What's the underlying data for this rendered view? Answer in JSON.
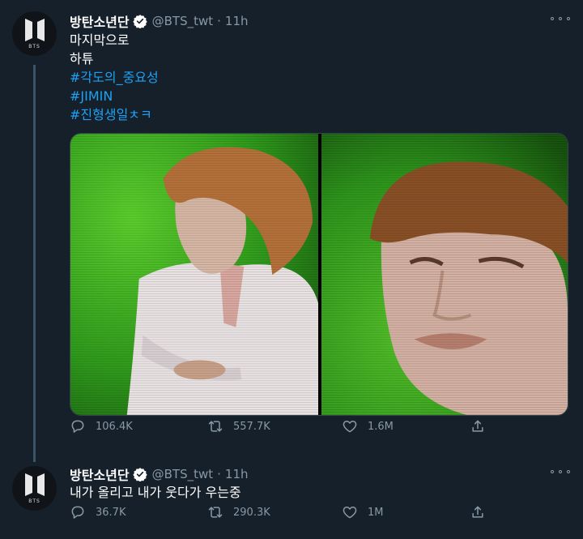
{
  "tweets": [
    {
      "display_name": "방탄소년단",
      "handle": "@BTS_twt",
      "separator": "·",
      "time": "11h",
      "avatar_logo": "BTS",
      "text_lines": [
        "마지막으로",
        "하튜"
      ],
      "hashtags": [
        "#각도의_중요성",
        "#JIMIN",
        "#진형생일ㅊㅋ"
      ],
      "media": [
        {
          "description_icon": "photo-icon"
        },
        {
          "description_icon": "photo-icon"
        }
      ],
      "stats": {
        "replies": "106.4K",
        "retweets": "557.7K",
        "likes": "1.6M"
      }
    },
    {
      "display_name": "방탄소년단",
      "handle": "@BTS_twt",
      "separator": "·",
      "time": "11h",
      "avatar_logo": "BTS",
      "text_lines": [
        "내가 올리고 내가 웃다가 우는중"
      ],
      "stats": {
        "replies": "36.7K",
        "retweets": "290.3K",
        "likes": "1M"
      }
    }
  ],
  "colors": {
    "background": "#15202b",
    "hashtag": "#1da1f2",
    "muted": "#8899a6",
    "verified": "#ffffff",
    "green_screen": "#3aa81e"
  }
}
